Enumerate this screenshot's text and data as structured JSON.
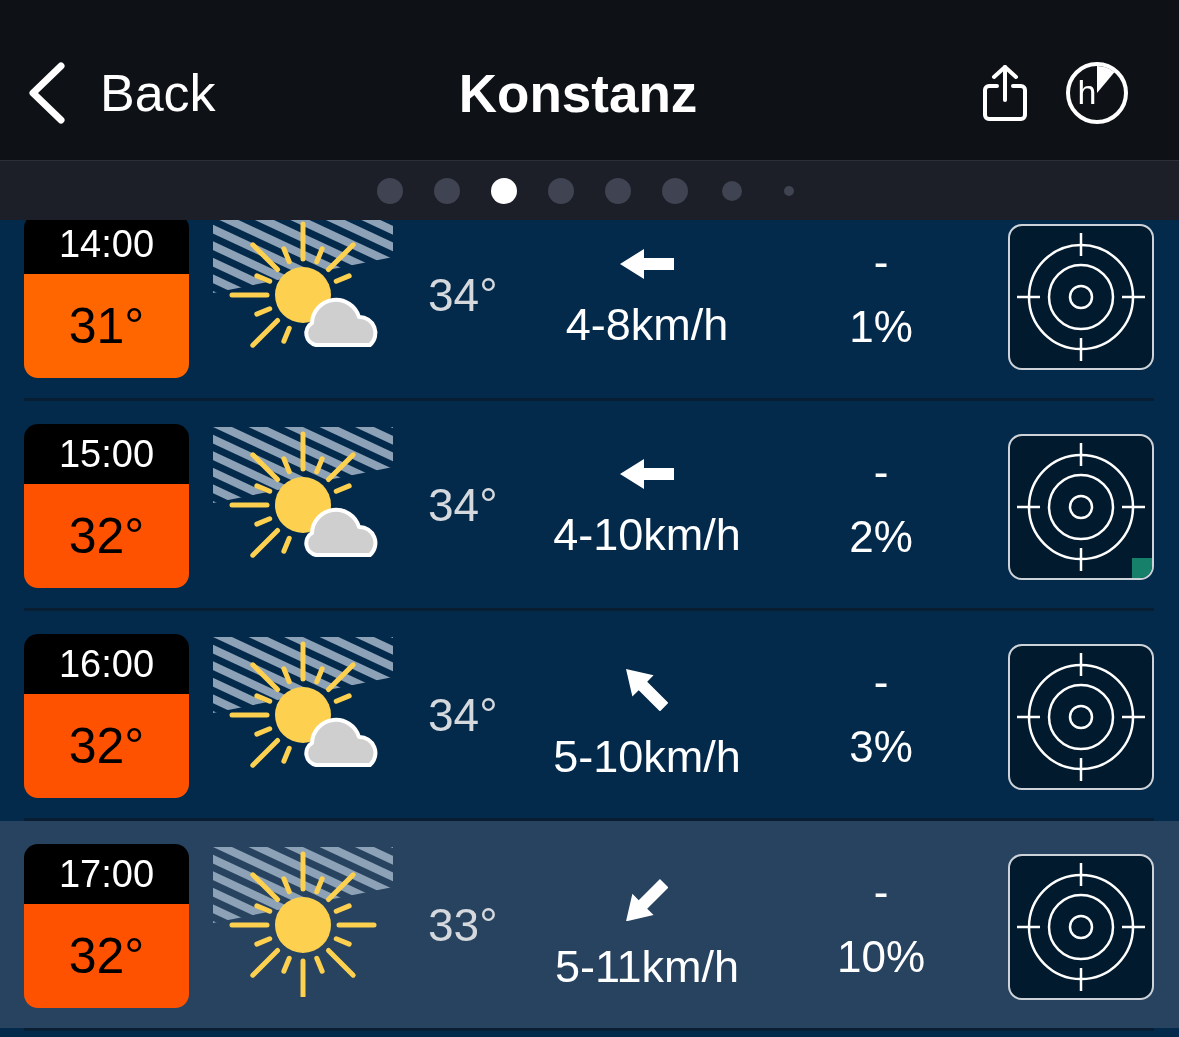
{
  "header": {
    "back_label": "Back",
    "title": "Konstanz",
    "mode_label": "h"
  },
  "pager": [
    {
      "kind": "full",
      "selected": false
    },
    {
      "kind": "full",
      "selected": false
    },
    {
      "kind": "full",
      "selected": true
    },
    {
      "kind": "full",
      "selected": false
    },
    {
      "kind": "full",
      "selected": false
    },
    {
      "kind": "full",
      "selected": false
    },
    {
      "kind": "small",
      "selected": false
    },
    {
      "kind": "tiny",
      "selected": false
    }
  ],
  "hours": [
    {
      "time": "14:00",
      "temperature": "31°",
      "color": "#ff6600",
      "icon": {
        "kind": "sun-cloud"
      },
      "feels_like": "34°",
      "wind": {
        "kind": "left",
        "speed": "4-8km/h"
      },
      "precip_amount": "-",
      "precip_chance": "1%",
      "flagged": false,
      "selected": false
    },
    {
      "time": "15:00",
      "temperature": "32°",
      "color": "#ff5200",
      "icon": {
        "kind": "sun-cloud"
      },
      "feels_like": "34°",
      "wind": {
        "kind": "left",
        "speed": "4-10km/h"
      },
      "precip_amount": "-",
      "precip_chance": "2%",
      "flagged": true,
      "selected": false
    },
    {
      "time": "16:00",
      "temperature": "32°",
      "color": "#ff5200",
      "icon": {
        "kind": "sun-cloud"
      },
      "feels_like": "34°",
      "wind": {
        "kind": "up-left",
        "speed": "5-10km/h"
      },
      "precip_amount": "-",
      "precip_chance": "3%",
      "flagged": false,
      "selected": false
    },
    {
      "time": "17:00",
      "temperature": "32°",
      "color": "#ff5200",
      "icon": {
        "kind": "sun"
      },
      "feels_like": "33°",
      "wind": {
        "kind": "down-left",
        "speed": "5-11km/h"
      },
      "precip_amount": "-",
      "precip_chance": "10%",
      "flagged": false,
      "selected": true
    }
  ]
}
